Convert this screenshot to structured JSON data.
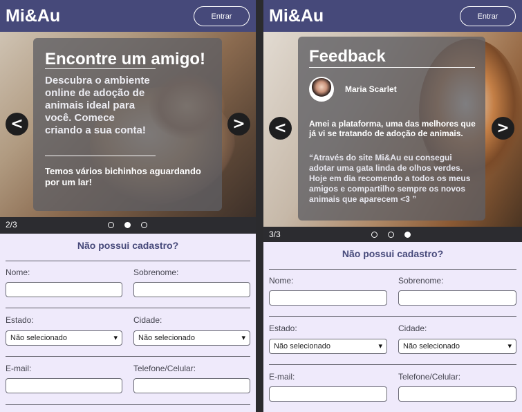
{
  "left": {
    "header": {
      "logo": "Mi&Au",
      "login_label": "Entrar"
    },
    "slide": {
      "title": "Encontre um amigo!",
      "body": "Descubra o ambiente online de adoção de animais ideal para você. Comece criando a sua conta!",
      "footer": "Temos vários bichinhos aguardando por um lar!"
    },
    "carousel": {
      "counter": "2/3",
      "prev_icon": "<",
      "next_icon": ">",
      "active_dot": 2,
      "dot_count": 3
    },
    "form": {
      "title": "Não possui cadastro?",
      "name_label": "Nome:",
      "surname_label": "Sobrenome:",
      "state_label": "Estado:",
      "state_value": "Não selecionado",
      "city_label": "Cidade:",
      "city_value": "Não selecionado",
      "email_label": "E-mail:",
      "phone_label": "Telefone/Celular:"
    }
  },
  "right": {
    "header": {
      "logo": "Mi&Au",
      "login_label": "Entrar"
    },
    "slide": {
      "title": "Feedback",
      "reviewer": "Maria Scarlet",
      "review": "Amei a plataforma, uma das melhores que já vi se tratando de adoção de animais.",
      "quote": "“Através do site Mi&Au eu consegui adotar uma gata linda de olhos verdes. Hoje em dia recomendo a todos os meus amigos e compartilho sempre os novos animais que aparecem <3 ”"
    },
    "carousel": {
      "counter": "3/3",
      "prev_icon": "<",
      "next_icon": ">",
      "active_dot": 3,
      "dot_count": 3
    },
    "form": {
      "title": "Não possui cadastro?",
      "name_label": "Nome:",
      "surname_label": "Sobrenome:",
      "state_label": "Estado:",
      "state_value": "Não selecionado",
      "city_label": "Cidade:",
      "city_value": "Não selecionado",
      "email_label": "E-mail:",
      "phone_label": "Telefone/Celular:"
    }
  },
  "colors": {
    "header": "#46497a",
    "form_bg": "#efeafb",
    "form_title": "#46497a",
    "dots_bar": "#2c2c30"
  }
}
